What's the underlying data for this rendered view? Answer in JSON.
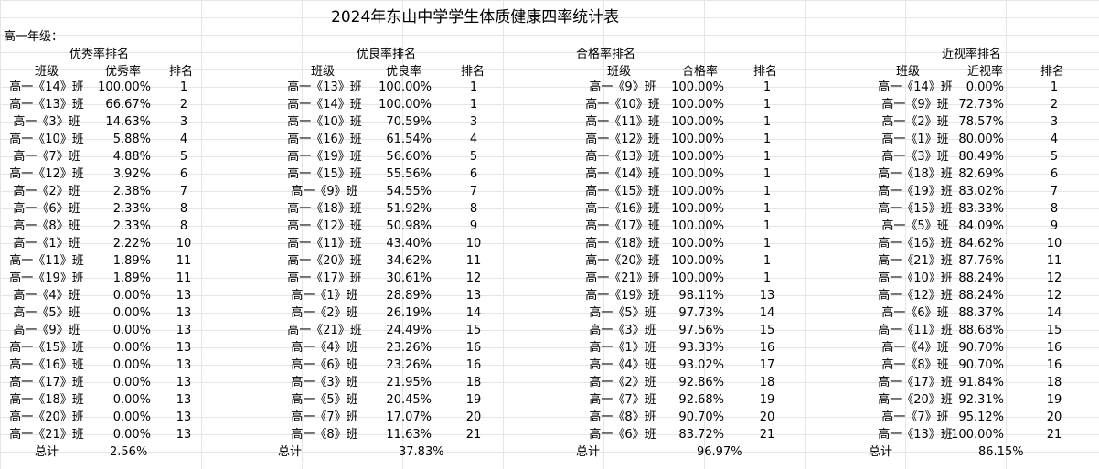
{
  "title": "2024年东山中学学生体质健康四率统计表",
  "grade_label": "高一年级：",
  "sections": [
    {
      "title": "优秀率排名",
      "col_class": "班级",
      "col_rate": "优秀率",
      "col_rank": "排名",
      "rows": [
        {
          "cls": "高一《14》班",
          "rate": "100.00%",
          "rank": "1"
        },
        {
          "cls": "高一《13》班",
          "rate": "66.67%",
          "rank": "2"
        },
        {
          "cls": "高一《3》班",
          "rate": "14.63%",
          "rank": "3"
        },
        {
          "cls": "高一《10》班",
          "rate": "5.88%",
          "rank": "4"
        },
        {
          "cls": "高一《7》班",
          "rate": "4.88%",
          "rank": "5"
        },
        {
          "cls": "高一《12》班",
          "rate": "3.92%",
          "rank": "6"
        },
        {
          "cls": "高一《2》班",
          "rate": "2.38%",
          "rank": "7"
        },
        {
          "cls": "高一《6》班",
          "rate": "2.33%",
          "rank": "8"
        },
        {
          "cls": "高一《8》班",
          "rate": "2.33%",
          "rank": "8"
        },
        {
          "cls": "高一《1》班",
          "rate": "2.22%",
          "rank": "10"
        },
        {
          "cls": "高一《11》班",
          "rate": "1.89%",
          "rank": "11"
        },
        {
          "cls": "高一《19》班",
          "rate": "1.89%",
          "rank": "11"
        },
        {
          "cls": "高一《4》班",
          "rate": "0.00%",
          "rank": "13"
        },
        {
          "cls": "高一《5》班",
          "rate": "0.00%",
          "rank": "13"
        },
        {
          "cls": "高一《9》班",
          "rate": "0.00%",
          "rank": "13"
        },
        {
          "cls": "高一《15》班",
          "rate": "0.00%",
          "rank": "13"
        },
        {
          "cls": "高一《16》班",
          "rate": "0.00%",
          "rank": "13"
        },
        {
          "cls": "高一《17》班",
          "rate": "0.00%",
          "rank": "13"
        },
        {
          "cls": "高一《18》班",
          "rate": "0.00%",
          "rank": "13"
        },
        {
          "cls": "高一《20》班",
          "rate": "0.00%",
          "rank": "13"
        },
        {
          "cls": "高一《21》班",
          "rate": "0.00%",
          "rank": "13"
        }
      ],
      "total_label": "总计",
      "total_value": "2.56%"
    },
    {
      "title": "优良率排名",
      "col_class": "班级",
      "col_rate": "优良率",
      "col_rank": "排名",
      "rows": [
        {
          "cls": "高一《13》班",
          "rate": "100.00%",
          "rank": "1"
        },
        {
          "cls": "高一《14》班",
          "rate": "100.00%",
          "rank": "1"
        },
        {
          "cls": "高一《10》班",
          "rate": "70.59%",
          "rank": "3"
        },
        {
          "cls": "高一《16》班",
          "rate": "61.54%",
          "rank": "4"
        },
        {
          "cls": "高一《19》班",
          "rate": "56.60%",
          "rank": "5"
        },
        {
          "cls": "高一《15》班",
          "rate": "55.56%",
          "rank": "6"
        },
        {
          "cls": "高一《9》班",
          "rate": "54.55%",
          "rank": "7"
        },
        {
          "cls": "高一《18》班",
          "rate": "51.92%",
          "rank": "8"
        },
        {
          "cls": "高一《12》班",
          "rate": "50.98%",
          "rank": "9"
        },
        {
          "cls": "高一《11》班",
          "rate": "43.40%",
          "rank": "10"
        },
        {
          "cls": "高一《20》班",
          "rate": "34.62%",
          "rank": "11"
        },
        {
          "cls": "高一《17》班",
          "rate": "30.61%",
          "rank": "12"
        },
        {
          "cls": "高一《1》班",
          "rate": "28.89%",
          "rank": "13"
        },
        {
          "cls": "高一《2》班",
          "rate": "26.19%",
          "rank": "14"
        },
        {
          "cls": "高一《21》班",
          "rate": "24.49%",
          "rank": "15"
        },
        {
          "cls": "高一《4》班",
          "rate": "23.26%",
          "rank": "16"
        },
        {
          "cls": "高一《6》班",
          "rate": "23.26%",
          "rank": "16"
        },
        {
          "cls": "高一《3》班",
          "rate": "21.95%",
          "rank": "18"
        },
        {
          "cls": "高一《5》班",
          "rate": "20.45%",
          "rank": "19"
        },
        {
          "cls": "高一《7》班",
          "rate": "17.07%",
          "rank": "20"
        },
        {
          "cls": "高一《8》班",
          "rate": "11.63%",
          "rank": "21"
        }
      ],
      "total_label": "总计",
      "total_value": "37.83%"
    },
    {
      "title": "合格率排名",
      "col_class": "班级",
      "col_rate": "合格率",
      "col_rank": "排名",
      "rows": [
        {
          "cls": "高一《9》班",
          "rate": "100.00%",
          "rank": "1"
        },
        {
          "cls": "高一《10》班",
          "rate": "100.00%",
          "rank": "1"
        },
        {
          "cls": "高一《11》班",
          "rate": "100.00%",
          "rank": "1"
        },
        {
          "cls": "高一《12》班",
          "rate": "100.00%",
          "rank": "1"
        },
        {
          "cls": "高一《13》班",
          "rate": "100.00%",
          "rank": "1"
        },
        {
          "cls": "高一《14》班",
          "rate": "100.00%",
          "rank": "1"
        },
        {
          "cls": "高一《15》班",
          "rate": "100.00%",
          "rank": "1"
        },
        {
          "cls": "高一《16》班",
          "rate": "100.00%",
          "rank": "1"
        },
        {
          "cls": "高一《17》班",
          "rate": "100.00%",
          "rank": "1"
        },
        {
          "cls": "高一《18》班",
          "rate": "100.00%",
          "rank": "1"
        },
        {
          "cls": "高一《20》班",
          "rate": "100.00%",
          "rank": "1"
        },
        {
          "cls": "高一《21》班",
          "rate": "100.00%",
          "rank": "1"
        },
        {
          "cls": "高一《19》班",
          "rate": "98.11%",
          "rank": "13"
        },
        {
          "cls": "高一《5》班",
          "rate": "97.73%",
          "rank": "14"
        },
        {
          "cls": "高一《3》班",
          "rate": "97.56%",
          "rank": "15"
        },
        {
          "cls": "高一《1》班",
          "rate": "93.33%",
          "rank": "16"
        },
        {
          "cls": "高一《4》班",
          "rate": "93.02%",
          "rank": "17"
        },
        {
          "cls": "高一《2》班",
          "rate": "92.86%",
          "rank": "18"
        },
        {
          "cls": "高一《7》班",
          "rate": "92.68%",
          "rank": "19"
        },
        {
          "cls": "高一《8》班",
          "rate": "90.70%",
          "rank": "20"
        },
        {
          "cls": "高一《6》班",
          "rate": "83.72%",
          "rank": "21"
        }
      ],
      "total_label": "总计",
      "total_value": "96.97%"
    },
    {
      "title": "近视率排名",
      "col_class": "班级",
      "col_rate": "近视率",
      "col_rank": "排名",
      "rows": [
        {
          "cls": "高一《14》班",
          "rate": "0.00%",
          "rank": "1"
        },
        {
          "cls": "高一《9》班",
          "rate": "72.73%",
          "rank": "2"
        },
        {
          "cls": "高一《2》班",
          "rate": "78.57%",
          "rank": "3"
        },
        {
          "cls": "高一《1》班",
          "rate": "80.00%",
          "rank": "4"
        },
        {
          "cls": "高一《3》班",
          "rate": "80.49%",
          "rank": "5"
        },
        {
          "cls": "高一《18》班",
          "rate": "82.69%",
          "rank": "6"
        },
        {
          "cls": "高一《19》班",
          "rate": "83.02%",
          "rank": "7"
        },
        {
          "cls": "高一《15》班",
          "rate": "83.33%",
          "rank": "8"
        },
        {
          "cls": "高一《5》班",
          "rate": "84.09%",
          "rank": "9"
        },
        {
          "cls": "高一《16》班",
          "rate": "84.62%",
          "rank": "10"
        },
        {
          "cls": "高一《21》班",
          "rate": "87.76%",
          "rank": "11"
        },
        {
          "cls": "高一《10》班",
          "rate": "88.24%",
          "rank": "12"
        },
        {
          "cls": "高一《12》班",
          "rate": "88.24%",
          "rank": "12"
        },
        {
          "cls": "高一《6》班",
          "rate": "88.37%",
          "rank": "14"
        },
        {
          "cls": "高一《11》班",
          "rate": "88.68%",
          "rank": "15"
        },
        {
          "cls": "高一《4》班",
          "rate": "90.70%",
          "rank": "16"
        },
        {
          "cls": "高一《8》班",
          "rate": "90.70%",
          "rank": "16"
        },
        {
          "cls": "高一《17》班",
          "rate": "91.84%",
          "rank": "18"
        },
        {
          "cls": "高一《20》班",
          "rate": "92.31%",
          "rank": "19"
        },
        {
          "cls": "高一《7》班",
          "rate": "95.12%",
          "rank": "20"
        },
        {
          "cls": "高一《13》班",
          "rate": "100.00%",
          "rank": "21"
        }
      ],
      "total_label": "总计",
      "total_value": "86.15%"
    }
  ]
}
